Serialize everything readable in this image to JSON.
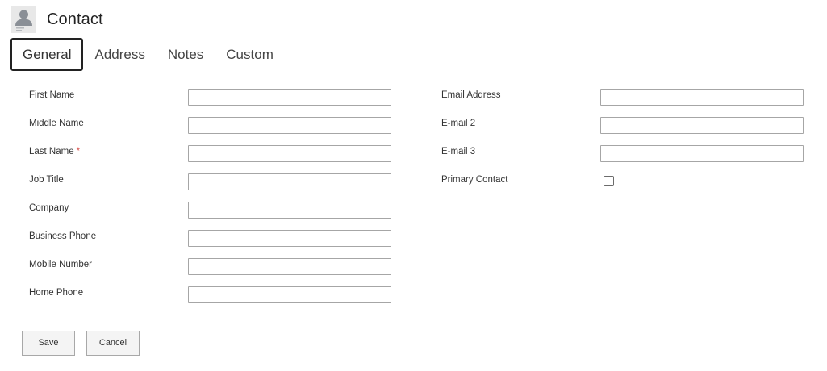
{
  "header": {
    "title": "Contact",
    "avatar_icon": "contact-person-icon"
  },
  "tabs": [
    {
      "label": "General",
      "active": true
    },
    {
      "label": "Address",
      "active": false
    },
    {
      "label": "Notes",
      "active": false
    },
    {
      "label": "Custom",
      "active": false
    }
  ],
  "left_fields": [
    {
      "label": "First Name",
      "value": "",
      "required": false
    },
    {
      "label": "Middle Name",
      "value": "",
      "required": false
    },
    {
      "label": "Last Name",
      "value": "",
      "required": true,
      "required_mark": "*"
    },
    {
      "label": "Job Title",
      "value": "",
      "required": false
    },
    {
      "label": "Company",
      "value": "",
      "required": false
    },
    {
      "label": "Business Phone",
      "value": "",
      "required": false
    },
    {
      "label": "Mobile Number",
      "value": "",
      "required": false
    },
    {
      "label": "Home Phone",
      "value": "",
      "required": false
    }
  ],
  "right_fields": [
    {
      "label": "Email Address",
      "value": ""
    },
    {
      "label": "E-mail 2",
      "value": ""
    },
    {
      "label": "E-mail 3",
      "value": ""
    }
  ],
  "primary_contact": {
    "label": "Primary Contact",
    "checked": false
  },
  "actions": {
    "save_label": "Save",
    "cancel_label": "Cancel"
  },
  "colors": {
    "required": "#d9534f",
    "field_border": "#a6a6a6",
    "tab_active_border": "#222222",
    "button_bg": "#f4f4f4"
  }
}
